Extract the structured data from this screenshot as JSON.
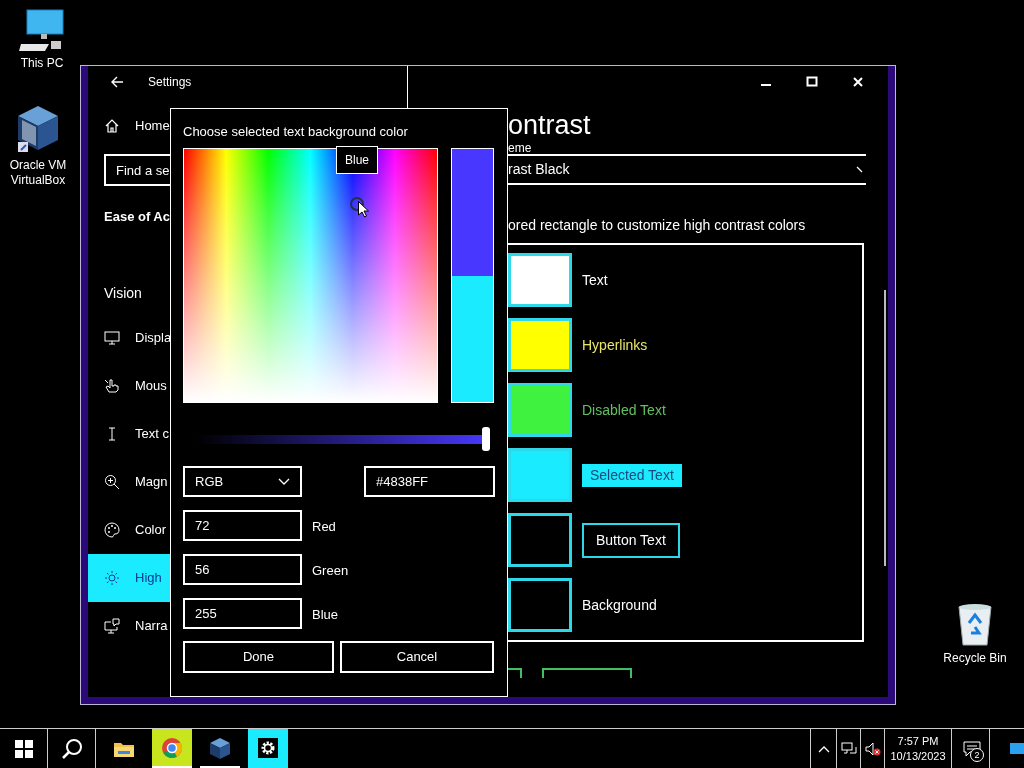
{
  "desktop_icons": [
    {
      "kind": "pc",
      "label": "This PC"
    },
    {
      "kind": "virtualbox",
      "label": "Oracle VM VirtualBox"
    },
    {
      "kind": "recycle",
      "label": "Recycle Bin"
    }
  ],
  "settings_window": {
    "title": "Settings",
    "sidebar": {
      "home": "Home",
      "search_placeholder": "Find a se",
      "section": "Ease of Ac",
      "group": "Vision",
      "items": [
        {
          "kind": "display",
          "label": "Displa",
          "selected": false
        },
        {
          "kind": "mouse",
          "label": "Mous",
          "selected": false
        },
        {
          "kind": "text",
          "label": "Text c",
          "selected": false
        },
        {
          "kind": "magnifier",
          "label": "Magn",
          "selected": false
        },
        {
          "kind": "color",
          "label": "Color",
          "selected": false
        },
        {
          "kind": "contrast",
          "label": "High",
          "selected": true
        },
        {
          "kind": "narrator",
          "label": "Narra",
          "selected": false
        }
      ]
    },
    "content": {
      "heading": "ontrast",
      "theme_label": "eme",
      "theme_value": "rast Black",
      "instruction": "ored rectangle to customize high contrast colors",
      "colors": [
        {
          "kind": "text",
          "label": "Text",
          "color": "#ffffff"
        },
        {
          "kind": "hyperlink",
          "label": "Hyperlinks",
          "color": "#ffff00"
        },
        {
          "kind": "disabled",
          "label": "Disabled Text",
          "color": "#3ff23f"
        },
        {
          "kind": "selected",
          "label": "Selected Text",
          "color": "#1aebff"
        },
        {
          "kind": "button",
          "label": "Button Text",
          "color": "#000000"
        },
        {
          "kind": "background",
          "label": "Background",
          "color": "#000000"
        }
      ]
    }
  },
  "color_dialog": {
    "title": "Choose selected text background color",
    "tooltip": "Blue",
    "preview": [
      {
        "color": "#4838ff"
      },
      {
        "color": "#1aebff"
      }
    ],
    "brightness": {
      "level": 1
    },
    "mode": "RGB",
    "hex": "#4838FF",
    "channels": [
      {
        "value": "72",
        "label": "Red"
      },
      {
        "value": "56",
        "label": "Green"
      },
      {
        "value": "255",
        "label": "Blue"
      }
    ],
    "buttons": [
      "Done",
      "Cancel"
    ]
  },
  "taskbar": {
    "apps": [
      {
        "kind": "explorer",
        "running": false,
        "selected": false,
        "flashing": false
      },
      {
        "kind": "chrome",
        "running": true,
        "selected": false,
        "flashing": true
      },
      {
        "kind": "virtualbox",
        "running": true,
        "selected": false,
        "flashing": false
      },
      {
        "kind": "settings",
        "running": true,
        "selected": true,
        "flashing": false
      }
    ],
    "time": "7:57 PM",
    "date": "10/13/2023",
    "notification_count": "2"
  }
}
